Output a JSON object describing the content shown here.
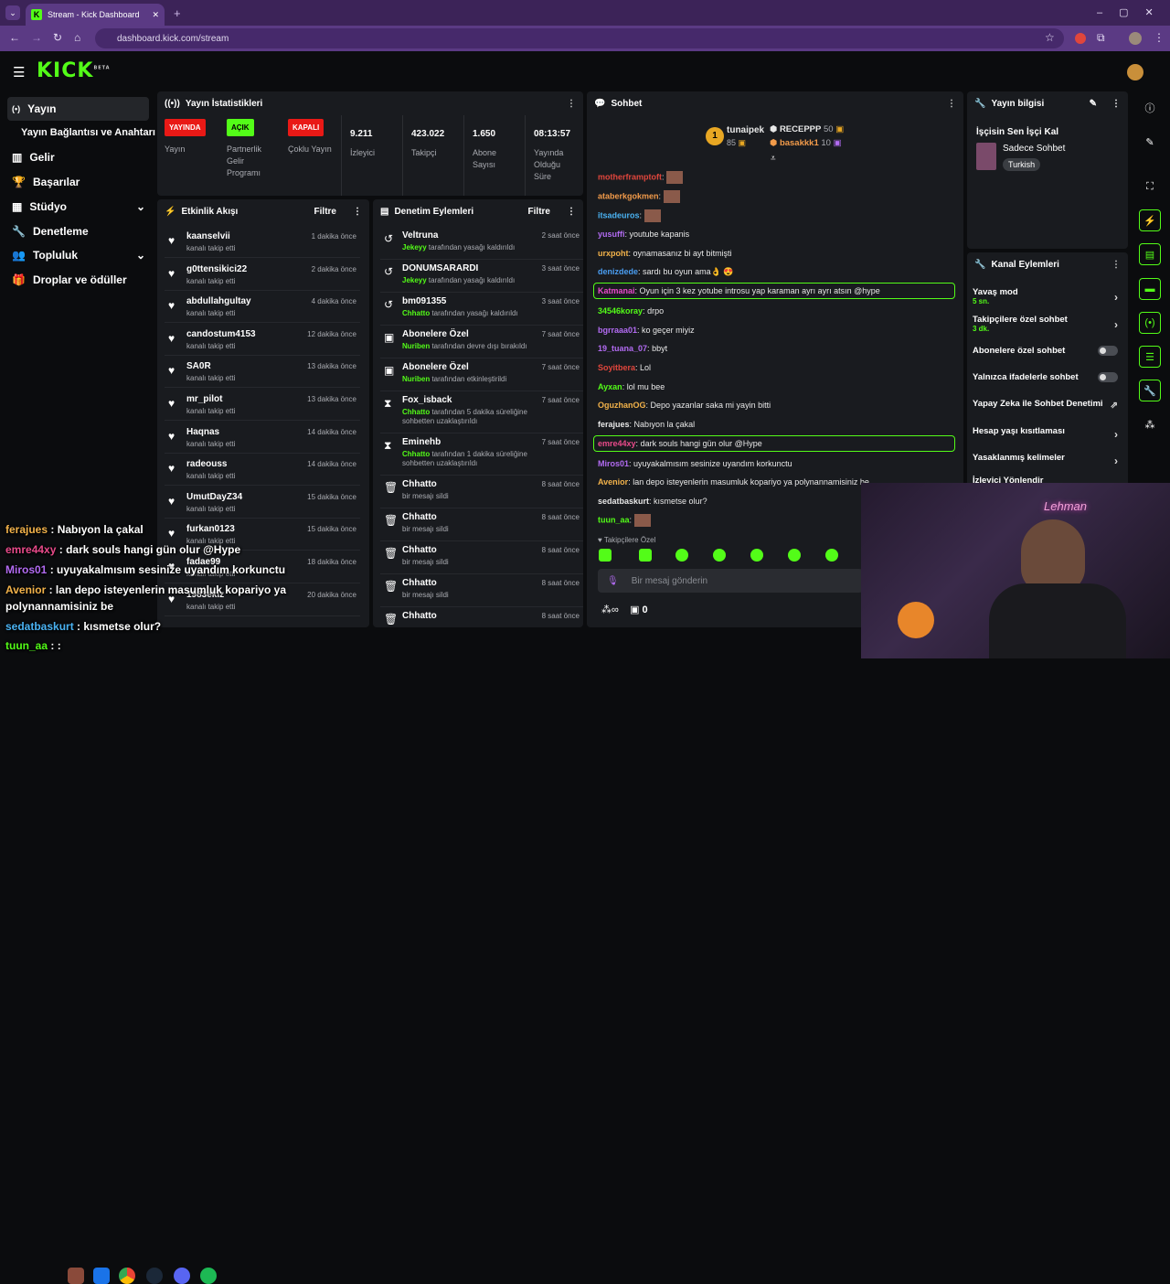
{
  "browser": {
    "tab_title": "Stream - Kick Dashboard",
    "url": "dashboard.kick.com/stream"
  },
  "app": {
    "logo": "KICK",
    "logo_sup": "BETA"
  },
  "sidebar": {
    "items": [
      {
        "label": "Yayın",
        "icon": "broadcast-icon"
      },
      {
        "label": "Yayın Bağlantısı ve Anahtarı",
        "icon": ""
      },
      {
        "label": "Gelir",
        "icon": "chart-icon"
      },
      {
        "label": "Başarılar",
        "icon": "trophy-icon"
      },
      {
        "label": "Stüdyo",
        "icon": "studio-icon"
      },
      {
        "label": "Denetleme",
        "icon": "wrench-icon"
      },
      {
        "label": "Topluluk",
        "icon": "community-icon"
      },
      {
        "label": "Droplar ve ödüller",
        "icon": "gift-icon"
      }
    ]
  },
  "stats": {
    "title": "Yayın İstatistikleri",
    "badges": [
      {
        "text": "YAYINDA",
        "label": "Yayın",
        "color": "#e91916"
      },
      {
        "text": "AÇIK",
        "label": "Partnerlik Gelir Programı",
        "color": "#53fc18"
      },
      {
        "text": "KAPALI",
        "label": "Çoklu Yayın",
        "color": "#e91916"
      }
    ],
    "values": [
      {
        "v": "9.211",
        "label": "İzleyici"
      },
      {
        "v": "423.022",
        "label": "Takipçi"
      },
      {
        "v": "1.650",
        "label": "Abone Sayısı"
      },
      {
        "v": "08:13:57",
        "label": "Yayında Olduğu Süre"
      }
    ]
  },
  "activity": {
    "title": "Etkinlik Akışı",
    "filter": "Filtre",
    "rows": [
      {
        "name": "kaanselvii",
        "sub": "kanalı takip etti",
        "time": "1 dakika önce"
      },
      {
        "name": "g0ttensikici22",
        "sub": "kanalı takip etti",
        "time": "2 dakika önce"
      },
      {
        "name": "abdullahgultay",
        "sub": "kanalı takip etti",
        "time": "4 dakika önce"
      },
      {
        "name": "candostum4153",
        "sub": "kanalı takip etti",
        "time": "12 dakika önce"
      },
      {
        "name": "SA0R",
        "sub": "kanalı takip etti",
        "time": "13 dakika önce"
      },
      {
        "name": "mr_pilot",
        "sub": "kanalı takip etti",
        "time": "13 dakika önce"
      },
      {
        "name": "Haqnas",
        "sub": "kanalı takip etti",
        "time": "14 dakika önce"
      },
      {
        "name": "radeouss",
        "sub": "kanalı takip etti",
        "time": "14 dakika önce"
      },
      {
        "name": "UmutDayZ34",
        "sub": "kanalı takip etti",
        "time": "15 dakika önce"
      },
      {
        "name": "furkan0123",
        "sub": "kanalı takip etti",
        "time": "15 dakika önce"
      },
      {
        "name": "fadae99",
        "sub": "kanalı takip etti",
        "time": "18 dakika önce"
      },
      {
        "name": "1983ekiz",
        "sub": "kanalı takip etti",
        "time": "20 dakika önce"
      }
    ]
  },
  "moderation": {
    "title": "Denetim Eylemleri",
    "filter": "Filtre",
    "rows": [
      {
        "icon": "undo-icon",
        "glyph": "↺",
        "name": "Veltruna",
        "actor": "Jekeyy",
        "sub": " tarafından yasağı kaldırıldı",
        "time": "2 saat önce",
        "h": 36
      },
      {
        "icon": "undo-icon",
        "glyph": "↺",
        "name": "DONUMSARARDI",
        "actor": "Jekeyy",
        "sub": " tarafından yasağı kaldırıldı",
        "time": "3 saat önce",
        "h": 36
      },
      {
        "icon": "undo-icon",
        "glyph": "↺",
        "name": "bm091355",
        "actor": "Chhatto",
        "sub": " tarafından yasağı kaldırıldı",
        "time": "3 saat önce",
        "h": 36
      },
      {
        "icon": "gift-icon",
        "glyph": "▣",
        "name": "Abonelere Özel",
        "actor": "Nuriben",
        "sub": " tarafından devre dışı bırakıldı",
        "time": "7 saat önce",
        "h": 36
      },
      {
        "icon": "gift-icon",
        "glyph": "▣",
        "name": "Abonelere Özel",
        "actor": "Nuriben",
        "sub": " tarafından etkinleştirildi",
        "time": "7 saat önce",
        "h": 36
      },
      {
        "icon": "hourglass-icon",
        "glyph": "⧗",
        "name": "Fox_isback",
        "actor": "Chhatto",
        "sub": " tarafından 5 dakika süreliğine sohbetten uzaklaştırıldı",
        "time": "7 saat önce",
        "h": 46
      },
      {
        "icon": "hourglass-icon",
        "glyph": "⧗",
        "name": "Eminehb",
        "actor": "Chhatto",
        "sub": " tarafından 1 dakika süreliğine sohbetten uzaklaştırıldı",
        "time": "7 saat önce",
        "h": 46
      },
      {
        "icon": "trash-icon",
        "glyph": "🗑",
        "name": "Chhatto",
        "actor": "",
        "sub": "bir mesajı sildi",
        "time": "8 saat önce",
        "h": 36
      },
      {
        "icon": "trash-icon",
        "glyph": "🗑",
        "name": "Chhatto",
        "actor": "",
        "sub": "bir mesajı sildi",
        "time": "8 saat önce",
        "h": 36
      },
      {
        "icon": "trash-icon",
        "glyph": "🗑",
        "name": "Chhatto",
        "actor": "",
        "sub": "bir mesajı sildi",
        "time": "8 saat önce",
        "h": 36
      },
      {
        "icon": "trash-icon",
        "glyph": "🗑",
        "name": "Chhatto",
        "actor": "",
        "sub": "bir mesajı sildi",
        "time": "8 saat önce",
        "h": 36
      },
      {
        "icon": "trash-icon",
        "glyph": "🗑",
        "name": "Chhatto",
        "actor": "",
        "sub": "",
        "time": "8 saat önce",
        "h": 36
      }
    ]
  },
  "chat": {
    "title": "Sohbet",
    "top_gifter": {
      "rank": "1",
      "name": "tunaipek",
      "count": "85"
    },
    "gifters": [
      {
        "name": "RECEPPP",
        "count": "50"
      },
      {
        "name": "basakkk1",
        "count": "10"
      }
    ],
    "messages": [
      {
        "user": "motherframptoft",
        "color": "#e0463c",
        "text": "",
        "hl": false
      },
      {
        "user": "ataberkgokmen",
        "color": "#f29b4a",
        "text": "",
        "hl": false
      },
      {
        "user": "itsadeuros",
        "color": "#4ab2f2",
        "text": "",
        "hl": false
      },
      {
        "user": "yusuffi",
        "color": "#b26bf2",
        "text": "youtube kapanis",
        "hl": false
      },
      {
        "user": "urxpoht",
        "color": "#f2b24a",
        "text": "oynamasanız bi ayt bitmişti",
        "hl": false
      },
      {
        "user": "denizdede",
        "color": "#4a9ef2",
        "text": "sardı bu oyun ama👌 😍",
        "hl": false
      },
      {
        "user": "Katmanai",
        "color": "#e84acb",
        "text": "Oyun için 3 kez yotube introsu yap karaman ayrı ayrı atsın @hype",
        "hl": true
      },
      {
        "user": "34546koray",
        "color": "#53fc18",
        "text": "drpo",
        "hl": false
      },
      {
        "user": "bgrraaa01",
        "color": "#b26bf2",
        "text": "ko geçer miyiz",
        "hl": false
      },
      {
        "user": "19_tuana_07",
        "color": "#b26bf2",
        "text": "bbyt",
        "hl": false
      },
      {
        "user": "Soyitbera",
        "color": "#e0463c",
        "text": "Lol",
        "hl": false
      },
      {
        "user": "Ayxan",
        "color": "#53fc18",
        "text": "lol mu bee",
        "hl": false
      },
      {
        "user": "OguzhanOG",
        "color": "#f2b24a",
        "text": "Depo yazanlar saka mi yayin bitti",
        "hl": false
      },
      {
        "user": "ferajues",
        "color": "#e8e8e8",
        "text": "Nabıyon la çakal",
        "hl": false
      },
      {
        "user": "emre44xy",
        "color": "#e84a8a",
        "text": "dark souls hangi gün olur @Hype",
        "hl": true
      },
      {
        "user": "Miros01",
        "color": "#b26bf2",
        "text": "uyuyakalmısım sesinize uyandım korkunctu",
        "hl": false
      },
      {
        "user": "Avenior",
        "color": "#f2b24a",
        "text": "lan depo isteyenlerin masumluk kopariyo ya polynannamisiniz be",
        "hl": false
      },
      {
        "user": "sedatbaskurt",
        "color": "#e8e8e8",
        "text": "kısmetse olur?",
        "hl": false
      },
      {
        "user": "tuun_aa",
        "color": "#53fc18",
        "text": "",
        "hl": false
      }
    ],
    "followers_only": "Takipçilere Özel",
    "placeholder": "Bir mesaj gönderin",
    "points": "0"
  },
  "stream_info": {
    "title": "Yayın bilgisi",
    "stream_title": "İşçisin Sen İşçi Kal",
    "category": "Sadece Sohbet",
    "tag": "Turkish"
  },
  "channel_actions": {
    "title": "Kanal Eylemleri",
    "rows": [
      {
        "label": "Yavaş mod",
        "sub": "5 sn.",
        "type": "arrow"
      },
      {
        "label": "Takipçilere özel sohbet",
        "sub": "3 dk.",
        "type": "arrow"
      },
      {
        "label": "Abonelere özel sohbet",
        "sub": "",
        "type": "toggle"
      },
      {
        "label": "Yalnızca ifadelerle sohbet",
        "sub": "",
        "type": "toggle"
      },
      {
        "label": "Yapay Zeka ile Sohbet Denetimi",
        "sub": "",
        "type": "ext"
      },
      {
        "label": "Hesap yaşı kısıtlaması",
        "sub": "",
        "type": "arrow"
      },
      {
        "label": "Yasaklanmış kelimeler",
        "sub": "",
        "type": "arrow"
      },
      {
        "label": "İzleyici Yönlendir",
        "sub": "",
        "type": "none"
      }
    ]
  },
  "overlay": {
    "lines": [
      {
        "user": "ferajues",
        "color": "#f2b24a",
        "text": "Nabıyon la çakal"
      },
      {
        "user": "emre44xy",
        "color": "#e84a8a",
        "text": "dark souls hangi gün olur @Hype"
      },
      {
        "user": "Miros01",
        "color": "#b26bf2",
        "text": "uyuyakalmısım sesinize uyandım korkunctu"
      },
      {
        "user": "Avenior",
        "color": "#f2b24a",
        "text": "lan depo isteyenlerin masumluk kopariyo ya"
      },
      {
        "user": "",
        "color": "#fff",
        "text": "polynannamisiniz be"
      },
      {
        "user": "sedatbaskurt",
        "color": "#4ab2f2",
        "text": "kısmetse olur?"
      },
      {
        "user": "tuun_aa",
        "color": "#53fc18",
        "text": ":"
      }
    ]
  },
  "webcam": {
    "neon": "Lehman"
  }
}
